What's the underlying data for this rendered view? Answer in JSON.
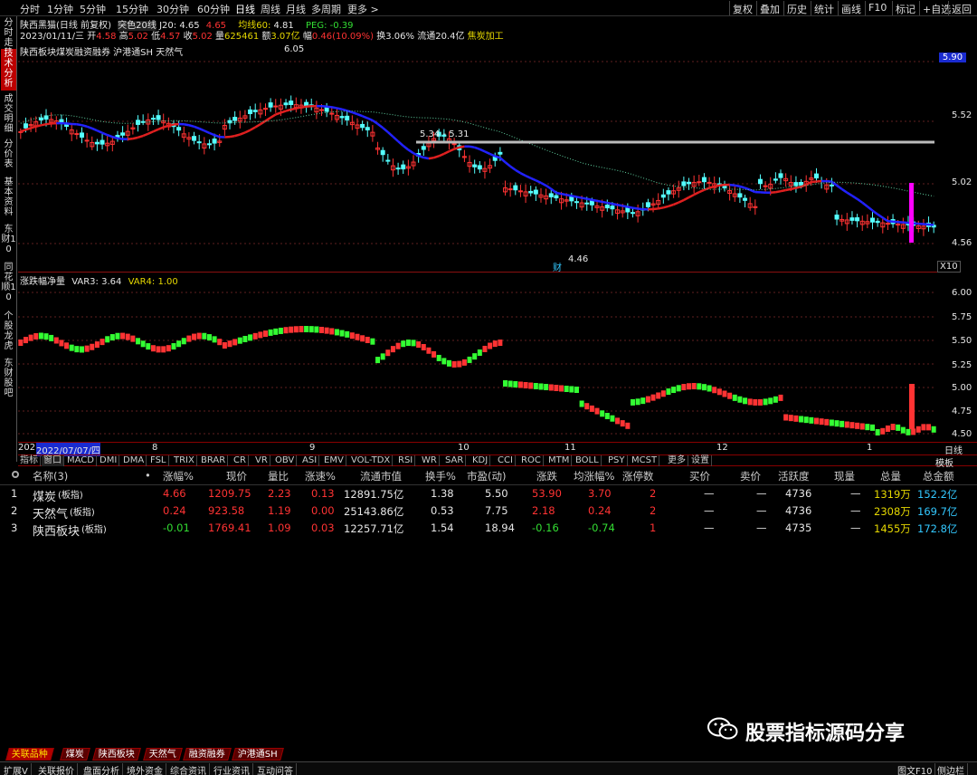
{
  "topbar": {
    "timeframes": [
      "分时",
      "1分钟",
      "5分钟",
      "15分钟",
      "30分钟",
      "60分钟",
      "日线",
      "周线",
      "月线",
      "多周期",
      "更多 >"
    ],
    "active_timeframe": "日线",
    "right_buttons": [
      "复权",
      "叠加",
      "历史",
      "统计",
      "画线",
      "F10",
      "标记",
      "+自选",
      "返回"
    ]
  },
  "left_nav": [
    "分时走势",
    "技术分析",
    "成交明细",
    "分价表",
    "基本资料",
    "东财10",
    "同花顺10",
    "个股龙虎",
    "东财股吧"
  ],
  "left_nav_active": "技术分析",
  "stock_info": {
    "name": "陕西黑猫(日线 前复权)",
    "indicator": "突色20线",
    "j20_label": "J20:",
    "j20_value": "4.65",
    "j20_value2": "4.65",
    "ma60_label": "均线60:",
    "ma60_value": "4.81",
    "peg_label": "PEG:",
    "peg_value": "-0.39",
    "date": "2023/01/11/三",
    "open_label": "开",
    "open": "4.58",
    "high_label": "高",
    "high": "5.02",
    "low_label": "低",
    "low": "4.57",
    "close_label": "收",
    "close": "5.02",
    "volume_label": "量",
    "volume": "625461",
    "amount_label": "额",
    "amount": "3.07亿",
    "change_label": "幅",
    "change": "0.46(10.09%)",
    "turnover": "换3.06%",
    "float_cap": "流通20.4亿",
    "concept": "焦炭加工",
    "sectors": "陕西板块煤炭融资融券 沪港通SH 天然气"
  },
  "main_chart": {
    "y_ticks": [
      "5.90",
      "5.52",
      "5.02",
      "4.56"
    ],
    "price_badge": "5.90",
    "high_label": "6.05",
    "low_label": "4.46",
    "range_label": "5.34 - 5.31",
    "fin_label": "财",
    "scale_label": "X10"
  },
  "sub_chart": {
    "title": "涨跌幅净量",
    "var3_label": "VAR3:",
    "var3": "3.64",
    "var4_label": "VAR4:",
    "var4": "1.00",
    "y_ticks": [
      "6.00",
      "5.75",
      "5.50",
      "5.25",
      "5.00",
      "4.75",
      "4.50"
    ]
  },
  "time_axis": {
    "labels": [
      "202",
      "2022/07/07/四",
      "8",
      "9",
      "10",
      "11",
      "12",
      "1"
    ],
    "period": "日线"
  },
  "indicator_tabs": [
    "指标",
    "窗口",
    "MACD",
    "DMI",
    "DMA",
    "FSL",
    "TRIX",
    "BRAR",
    "CR",
    "VR",
    "OBV",
    "ASI",
    "EMV",
    "VOL-TDX",
    "RSI",
    "WR",
    "SAR",
    "KDJ",
    "CCI",
    "ROC",
    "MTM",
    "BOLL",
    "PSY",
    "MCST",
    "更多",
    "设置"
  ],
  "template_label": "模板",
  "table": {
    "headers": [
      "名称(3)",
      "•",
      "涨幅%",
      "现价",
      "量比",
      "涨速%",
      "流通市值",
      "换手%",
      "市盈(动)",
      "涨跌",
      "均涨幅%",
      "涨停数",
      "买价",
      "卖价",
      "活跃度",
      "现量",
      "总量",
      "总金额"
    ],
    "rows": [
      {
        "idx": "1",
        "name": "煤炭",
        "tag": "(板指)",
        "chg": "4.66",
        "price": "1209.75",
        "vr": "2.23",
        "speed": "0.13",
        "cap": "12891.75亿",
        "turn": "1.38",
        "pe": "5.50",
        "diff": "53.90",
        "avg": "3.70",
        "limit": "2",
        "bid": "—",
        "ask": "—",
        "active": "4736",
        "curvol": "—",
        "vol": "1319万",
        "amt": "152.2亿"
      },
      {
        "idx": "2",
        "name": "天然气",
        "tag": "(板指)",
        "chg": "0.24",
        "price": "923.58",
        "vr": "1.19",
        "speed": "0.00",
        "cap": "25143.86亿",
        "turn": "0.53",
        "pe": "7.75",
        "diff": "2.18",
        "avg": "0.24",
        "limit": "2",
        "bid": "—",
        "ask": "—",
        "active": "4736",
        "curvol": "—",
        "vol": "2308万",
        "amt": "169.7亿"
      },
      {
        "idx": "3",
        "name": "陕西板块",
        "tag": "(板指)",
        "chg": "-0.01",
        "price": "1769.41",
        "vr": "1.09",
        "speed": "0.03",
        "cap": "12257.71亿",
        "turn": "1.54",
        "pe": "18.94",
        "diff": "-0.16",
        "avg": "-0.74",
        "limit": "1",
        "bid": "—",
        "ask": "—",
        "active": "4735",
        "curvol": "—",
        "vol": "1455万",
        "amt": "172.8亿"
      }
    ]
  },
  "watermark": "股票指标源码分享",
  "bottom_tabs": [
    "关联品种",
    "煤炭",
    "陕西板块",
    "天然气",
    "融资融券",
    "沪港通SH"
  ],
  "status_bar": [
    "扩展V",
    "关联报价",
    "盘面分析",
    "境外资金",
    "综合资讯",
    "行业资讯",
    "互动问答"
  ],
  "status_right": [
    "图文F10",
    "侧边栏"
  ],
  "colors": {
    "up": "#ff3333",
    "down": "#33dd33",
    "candle_down": "#54ffff",
    "ma_blue": "#2222ff",
    "ma_red": "#e02020",
    "magenta": "#ff00ff"
  }
}
